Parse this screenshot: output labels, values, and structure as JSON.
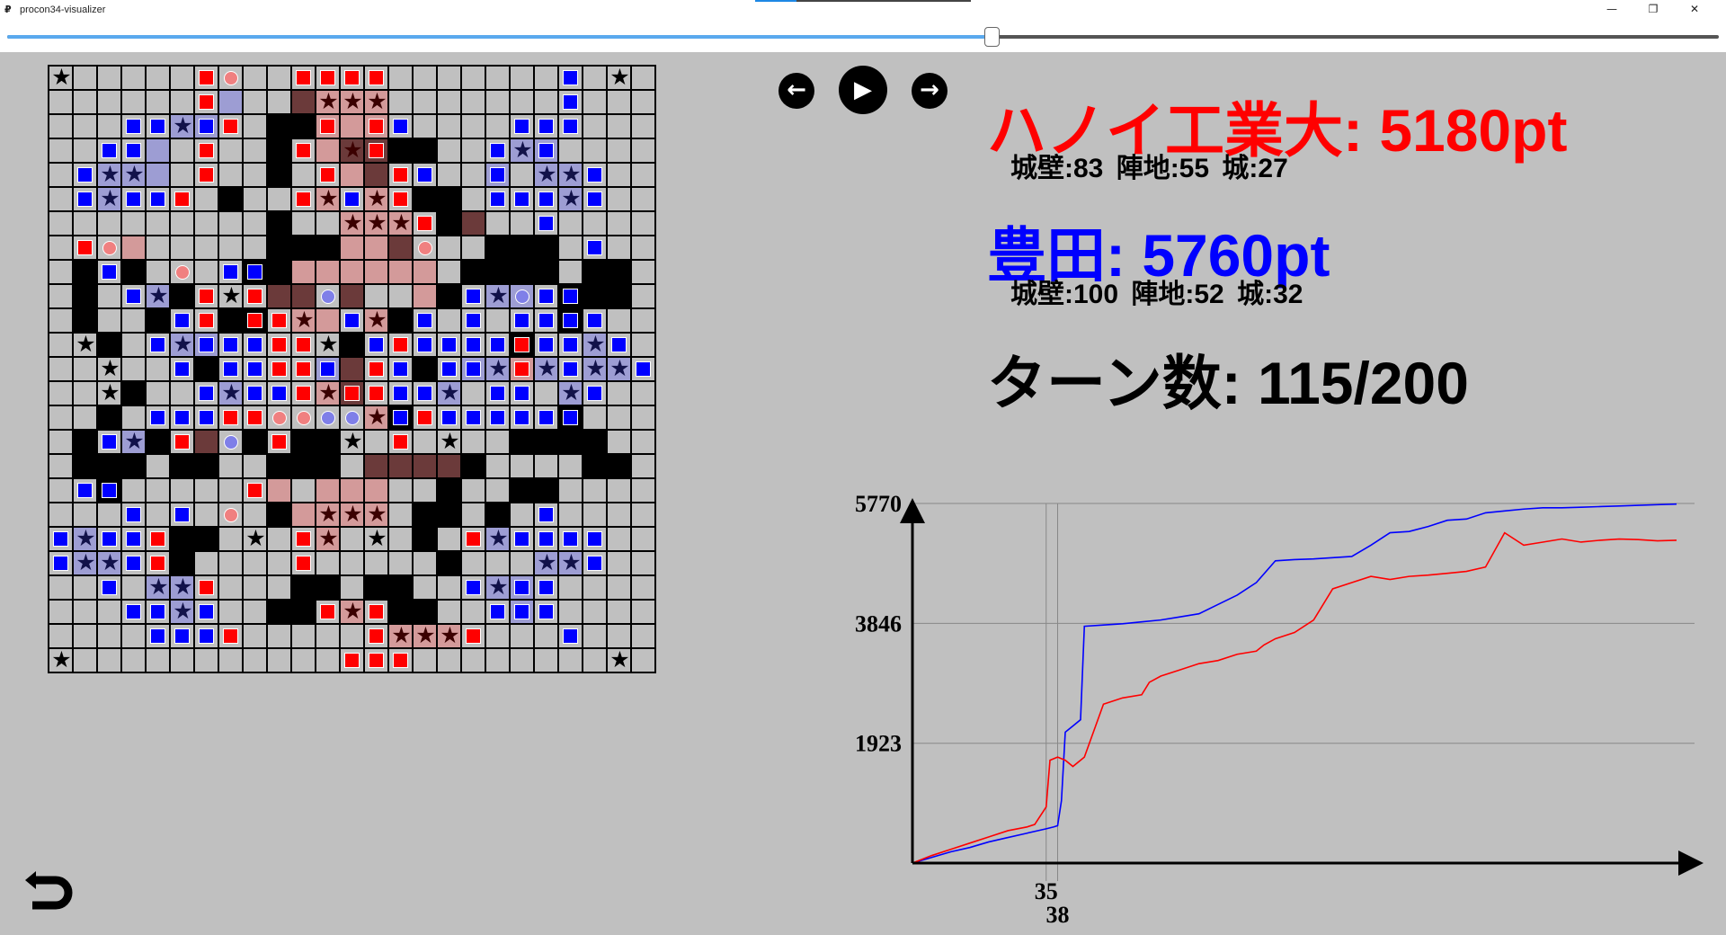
{
  "window": {
    "title": "procon34-visualizer",
    "icon": "app-icon",
    "minimize_label": "—",
    "maximize_label": "❐",
    "close_label": "✕"
  },
  "slider": {
    "value": 115,
    "max": 200,
    "fraction": 0.575
  },
  "controls": {
    "prev_label": "←",
    "play_label": "▶",
    "next_label": "→",
    "back_icon": "undo-icon"
  },
  "teams": {
    "red": {
      "score_text": "ハノイ工業大: 5180pt",
      "stats_text": "城壁:83 陣地:55 城:27",
      "color": "#ff0000"
    },
    "blue": {
      "score_text": "豊田: 5760pt",
      "stats_text": "城壁:100 陣地:52 城:32",
      "color": "#0000ff"
    }
  },
  "turn_text": "ターン数: 115/200",
  "board": {
    "size": 25,
    "legend": {
      ".": "empty",
      "P": "pond",
      "r": "red wall",
      "b": "blue wall",
      "R": "red wall on pond",
      "B": "blue wall on pond",
      "c": "castle",
      "x": "red territory",
      "y": "blue territory",
      "z": "both territory",
      "X": "castle in red territory",
      "Y": "castle in blue territory",
      "Z": "castle in both territory",
      "a": "red agent",
      "A": "blue agent",
      "e": "red wall in red territory",
      "f": "blue wall in blue territory",
      "g": "red wall in both territory",
      "h": "blue wall in both territory",
      "i": "red agent in red territory",
      "j": "blue agent in blue territory",
      "k": "blue agent in both territory",
      "l": "red agent in both territory"
    },
    "rows": [
      "c.....ra..rrrr.......b.c.",
      "......ry..zXXX.......b...",
      "...bbYfr.PPexeb....bbb...",
      "..bby.r..PrxZgPP..bYf....",
      ".bYYy.r..P.rxzrb..f.YYb..",
      ".bYbbr.P..rXbXrPP.bbbYb..",
      ".........P..XXXrPz..b....",
      ".rax.....PPPxxza..PPP.b..",
      ".PbP.a.bBPxxxxxx.PPPP.PP.",
      ".P.bYPrcrzzAz..xPbYjbBPP.",
      ".P..PbrPRrXxbXPb.b.bbBb..",
      ".cP.bYfbbrrcPbrbbbbRbbYb.",
      "..c..bPbbrrfzrbPbfYeYbYYb",
      "..cP..bYbbrXgrbbY.bb.Yb..",
      "..P.bbbrraaAAXBrbbbbbB...",
      ".PbYPrzAPrPPc.r.c..PPPP..",
      ".PPP.PP..PPP.zzzzP....PP.",
      ".bB.....rx.xxx..P..PP....",
      "...b.b.a.PxXXX.PP.P.b....",
      "bYbbrPP.c.rX.c.P.rYbbbb..",
      "bYYbrP....r.....P...YYb..",
      "..b.YYr...PP.PP..bYfb....",
      "...bbYb..PPrXrPP..bfb....",
      "....bbbr.....rXXXr...b...",
      "c...........rrr........c."
    ]
  },
  "chart_data": {
    "type": "line",
    "ylim": [
      0,
      5770
    ],
    "yticks": [
      1923,
      3846,
      5770
    ],
    "xlim": [
      0,
      200
    ],
    "markers": [
      35,
      38
    ],
    "series": [
      {
        "color": "#0000ff",
        "x": [
          0,
          5,
          10,
          15,
          20,
          25,
          30,
          35,
          37,
          38,
          39,
          40,
          42,
          44,
          45,
          50,
          55,
          60,
          65,
          70,
          75,
          80,
          85,
          90,
          95,
          100,
          105,
          110,
          115,
          120,
          125,
          130,
          135,
          140,
          145,
          150,
          155,
          160,
          165,
          170,
          175,
          180,
          185,
          190,
          195,
          200
        ],
        "y": [
          0,
          90,
          180,
          250,
          340,
          410,
          480,
          550,
          580,
          600,
          1000,
          2100,
          2200,
          2300,
          3800,
          3820,
          3840,
          3870,
          3900,
          3950,
          4000,
          4150,
          4300,
          4500,
          4850,
          4870,
          4880,
          4900,
          4920,
          5100,
          5300,
          5320,
          5400,
          5500,
          5520,
          5620,
          5650,
          5680,
          5700,
          5700,
          5710,
          5720,
          5730,
          5740,
          5750,
          5760
        ]
      },
      {
        "color": "#ff0000",
        "x": [
          0,
          5,
          10,
          15,
          20,
          25,
          30,
          32,
          35,
          36,
          38,
          40,
          42,
          45,
          50,
          55,
          60,
          62,
          65,
          70,
          75,
          80,
          85,
          90,
          92,
          95,
          100,
          105,
          110,
          115,
          120,
          125,
          130,
          135,
          140,
          145,
          150,
          155,
          160,
          165,
          170,
          175,
          180,
          185,
          190,
          195,
          200
        ],
        "y": [
          0,
          120,
          220,
          320,
          420,
          520,
          580,
          620,
          900,
          1650,
          1700,
          1650,
          1550,
          1700,
          2550,
          2650,
          2700,
          2900,
          3000,
          3100,
          3200,
          3250,
          3350,
          3400,
          3500,
          3600,
          3700,
          3900,
          4400,
          4500,
          4600,
          4550,
          4600,
          4620,
          4650,
          4680,
          4750,
          5300,
          5100,
          5150,
          5200,
          5150,
          5180,
          5200,
          5190,
          5170,
          5180
        ]
      }
    ]
  }
}
